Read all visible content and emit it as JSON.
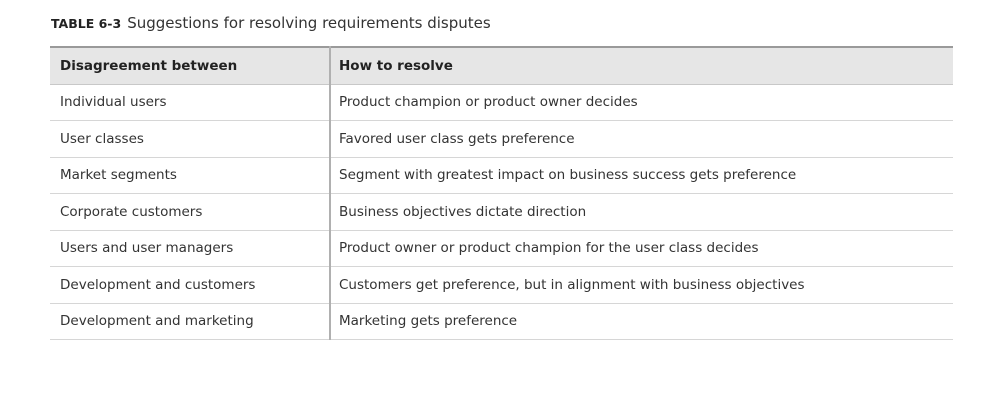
{
  "caption": {
    "label": "TABLE 6-3",
    "title": "Suggestions for resolving requirements disputes"
  },
  "table": {
    "headers": [
      "Disagreement between",
      "How to resolve"
    ],
    "rows": [
      [
        "Individual users",
        "Product champion or product owner decides"
      ],
      [
        "User classes",
        "Favored user class gets preference"
      ],
      [
        "Market segments",
        "Segment with greatest impact on business success gets preference"
      ],
      [
        "Corporate customers",
        "Business objectives dictate direction"
      ],
      [
        "Users and user managers",
        "Product owner or product champion for the user class decides"
      ],
      [
        "Development and customers",
        "Customers get preference, but in alignment with business objectives"
      ],
      [
        "Development and marketing",
        "Marketing gets preference"
      ]
    ]
  }
}
